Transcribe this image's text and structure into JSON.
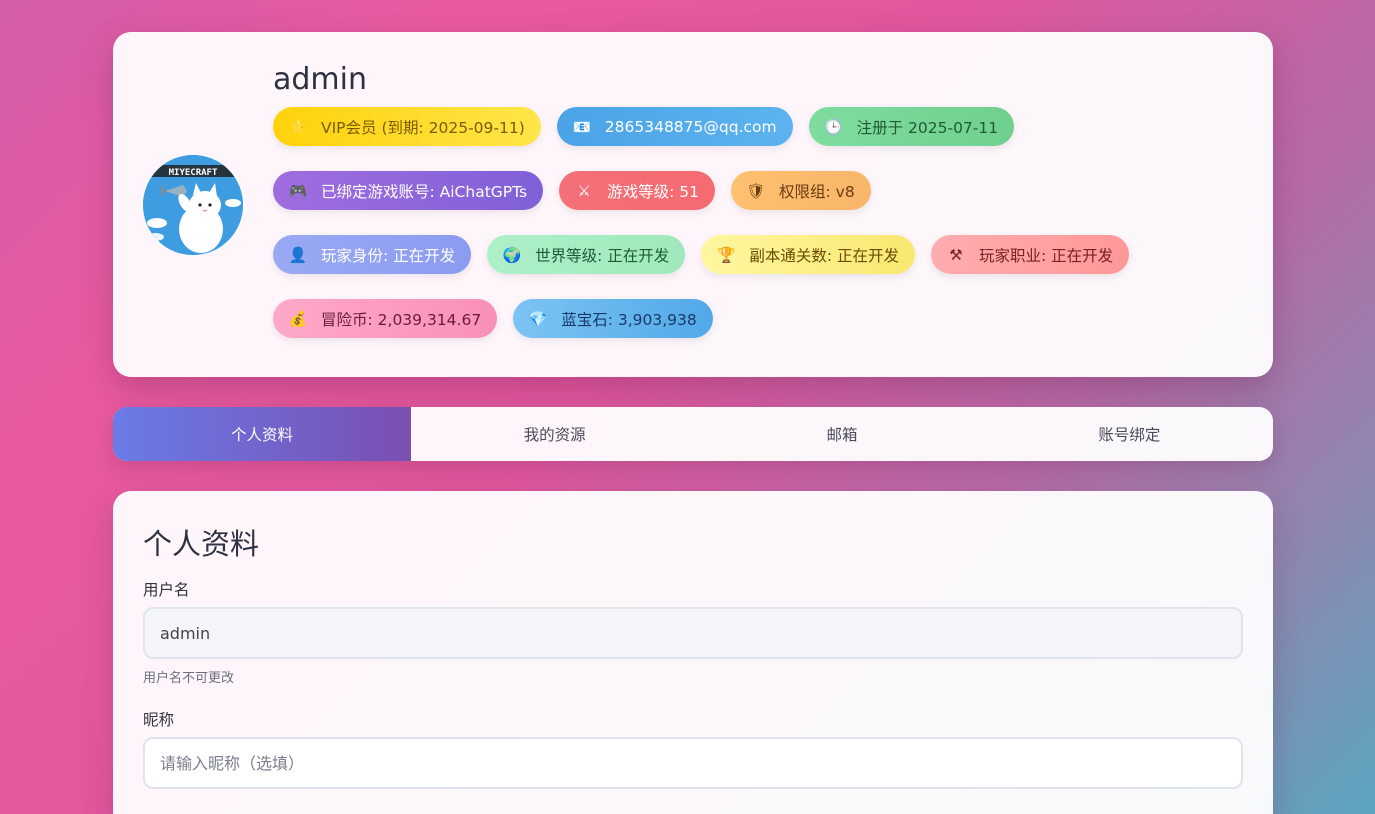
{
  "profile": {
    "username": "admin",
    "avatar_text": "MIYECRAFT",
    "badges": [
      [
        {
          "key": "vip",
          "icon": "⭐",
          "icon_name": "star-icon",
          "label": "VIP会员 (到期: 2025-09-11)"
        },
        {
          "key": "mail",
          "icon": "📧",
          "icon_name": "mail-icon",
          "label": "2865348875@qq.com"
        },
        {
          "key": "reg",
          "icon": "🕒",
          "icon_name": "clock-icon",
          "label": "注册于 2025-07-11"
        }
      ],
      [
        {
          "key": "game",
          "icon": "🎮",
          "icon_name": "gamepad-icon",
          "label": "已绑定游戏账号: AiChatGPTs"
        },
        {
          "key": "level",
          "icon": "⚔",
          "icon_name": "swords-icon",
          "label": "游戏等级: 51"
        },
        {
          "key": "perm",
          "icon": "🛡",
          "icon_name": "shield-icon",
          "label": "权限组: v8"
        }
      ],
      [
        {
          "key": "role",
          "icon": "👤",
          "icon_name": "person-icon",
          "label": "玩家身份: 正在开发"
        },
        {
          "key": "world",
          "icon": "🌍",
          "icon_name": "globe-icon",
          "label": "世界等级: 正在开发"
        },
        {
          "key": "dungeon",
          "icon": "🏆",
          "icon_name": "trophy-icon",
          "label": "副本通关数: 正在开发"
        },
        {
          "key": "job",
          "icon": "⚒",
          "icon_name": "tools-icon",
          "label": "玩家职业: 正在开发"
        }
      ],
      [
        {
          "key": "coin",
          "icon": "💰",
          "icon_name": "money-bag-icon",
          "label": "冒险币: 2,039,314.67"
        },
        {
          "key": "gem",
          "icon": "💎",
          "icon_name": "gem-icon",
          "label": "蓝宝石: 3,903,938"
        }
      ]
    ]
  },
  "tabs": [
    {
      "label": "个人资料",
      "active": true
    },
    {
      "label": "我的资源",
      "active": false
    },
    {
      "label": "邮箱",
      "active": false
    },
    {
      "label": "账号绑定",
      "active": false
    }
  ],
  "content": {
    "title": "个人资料",
    "username_label": "用户名",
    "username_value": "admin",
    "username_hint": "用户名不可更改",
    "nickname_label": "昵称",
    "nickname_value": "",
    "nickname_placeholder": "请输入昵称（选填）"
  }
}
